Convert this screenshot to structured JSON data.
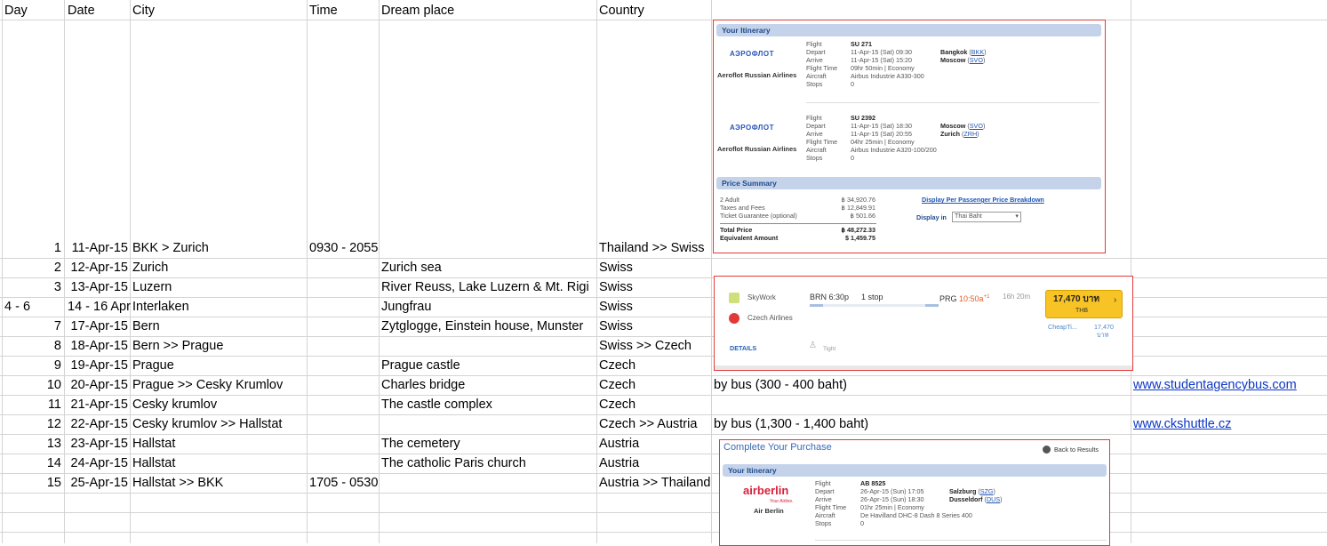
{
  "sheet": {
    "headers": [
      "Day",
      "Date",
      "City",
      "Time",
      "Dream place",
      "Country"
    ],
    "rows": [
      {
        "day": "1",
        "date": "11-Apr-15",
        "city": "BKK > Zurich",
        "time": "0930 - 2055",
        "place": "",
        "country": "Thailand >> Swiss",
        "note": "",
        "link": ""
      },
      {
        "day": "2",
        "date": "12-Apr-15",
        "city": "Zurich",
        "time": "",
        "place": "Zurich sea",
        "country": "Swiss",
        "note": "",
        "link": ""
      },
      {
        "day": "3",
        "date": "13-Apr-15",
        "city": "Luzern",
        "time": "",
        "place": "River Reuss, Lake Luzern & Mt. Rigi",
        "country": "Swiss",
        "note": "",
        "link": ""
      },
      {
        "day": "4 - 6",
        "date": "14 - 16 Apr",
        "city": "Interlaken",
        "time": "",
        "place": "Jungfrau",
        "country": "Swiss",
        "note": "",
        "link": ""
      },
      {
        "day": "7",
        "date": "17-Apr-15",
        "city": "Bern",
        "time": "",
        "place": "Zytglogge, Einstein house, Munster",
        "country": "Swiss",
        "note": "",
        "link": ""
      },
      {
        "day": "8",
        "date": "18-Apr-15",
        "city": "Bern >> Prague",
        "time": "",
        "place": "",
        "country": "Swiss >> Czech",
        "note": "",
        "link": ""
      },
      {
        "day": "9",
        "date": "19-Apr-15",
        "city": "Prague",
        "time": "",
        "place": "Prague castle",
        "country": "Czech",
        "note": "",
        "link": ""
      },
      {
        "day": "10",
        "date": "20-Apr-15",
        "city": "Prague >> Cesky Krumlov",
        "time": "",
        "place": "Charles bridge",
        "country": "Czech",
        "note": "by bus (300 - 400 baht)",
        "link": "www.studentagencybus.com"
      },
      {
        "day": "11",
        "date": "21-Apr-15",
        "city": "Cesky krumlov",
        "time": "",
        "place": "The castle complex",
        "country": "Czech",
        "note": "",
        "link": ""
      },
      {
        "day": "12",
        "date": "22-Apr-15",
        "city": "Cesky krumlov >> Hallstat",
        "time": "",
        "place": "",
        "country": "Czech >> Austria",
        "note": "by bus (1,300 - 1,400 baht)",
        "link": "www.ckshuttle.cz"
      },
      {
        "day": "13",
        "date": "23-Apr-15",
        "city": "Hallstat",
        "time": "",
        "place": "The cemetery",
        "country": "Austria",
        "note": "",
        "link": ""
      },
      {
        "day": "14",
        "date": "24-Apr-15",
        "city": "Hallstat",
        "time": "",
        "place": "The catholic Paris church",
        "country": "Austria",
        "note": "",
        "link": ""
      },
      {
        "day": "15",
        "date": "25-Apr-15",
        "city": "Hallstat >> BKK",
        "time": "1705 - 0530",
        "place": "",
        "country": "Austria >> Thailand",
        "note": "",
        "link": ""
      }
    ]
  },
  "shot1": {
    "itinerary_title": "Your Itinerary",
    "logo_text": "АЭРОФЛОТ",
    "airline": "Aeroflot Russian Airlines",
    "labels": [
      "Flight",
      "Depart",
      "Arrive",
      "Flight Time",
      "Aircraft",
      "Stops"
    ],
    "leg1": {
      "flight": "SU 271",
      "depart": "11-Apr-15 (Sat) 09:30",
      "arrive": "11-Apr-15 (Sat) 15:20",
      "time": "09hr 50min | Economy",
      "aircraft": "Airbus Industrie A330-300",
      "stops": "0",
      "from_city": "Bangkok",
      "from_code": "BKK",
      "to_city": "Moscow",
      "to_code": "SVO"
    },
    "leg2": {
      "flight": "SU 2392",
      "depart": "11-Apr-15 (Sat) 18:30",
      "arrive": "11-Apr-15 (Sat) 20:55",
      "time": "04hr 25min | Economy",
      "aircraft": "Airbus Industrie A320-100/200",
      "stops": "0",
      "from_city": "Moscow",
      "from_code": "SVO",
      "to_city": "Zurich",
      "to_code": "ZRH"
    },
    "price_title": "Price Summary",
    "price_labels": [
      "2 Adult",
      "Taxes and Fees",
      "Ticket Guarantee (optional)"
    ],
    "price_values": [
      "฿ 34,920.76",
      "฿ 12,849.91",
      "฿ 501.66"
    ],
    "total_label": "Total Price",
    "total_value": "฿ 48,272.33",
    "equiv_label": "Equivalent Amount",
    "equiv_value": "$ 1,459.75",
    "breakdown_link": "Display Per Passenger Price Breakdown",
    "display_in_label": "Display in",
    "currency_select": "Thai Baht"
  },
  "shot2": {
    "airline1": "SkyWork",
    "airline2": "Czech Airlines",
    "dep": "BRN 6:30p",
    "stops": "1 stop",
    "arr_code": "PRG",
    "arr_time": "10:50a",
    "plus": "+1",
    "duration": "16h 20m",
    "price": "17,470 บาท",
    "currency": "THB",
    "details": "DETAILS",
    "seat": "Tight",
    "provider": "CheapTi...",
    "provider_price": "17,470",
    "provider_unit": "บาท"
  },
  "shot3": {
    "title": "Complete Your Purchase",
    "back": "Back to Results",
    "itinerary_title": "Your Itinerary",
    "logo_text": "airberlin",
    "logo_tag": "Your Airline.",
    "airline": "Air Berlin",
    "labels": [
      "Flight",
      "Depart",
      "Arrive",
      "Flight Time",
      "Aircraft",
      "Stops"
    ],
    "leg": {
      "flight": "AB 8525",
      "depart": "26-Apr-15 (Sun) 17:05",
      "arrive": "26-Apr-15 (Sun) 18:30",
      "time": "01hr 25min | Economy",
      "aircraft": "De Havilland DHC-8 Dash 8 Series 400",
      "stops": "0",
      "from_city": "Salzburg",
      "from_code": "SZG",
      "to_city": "Dusseldorf",
      "to_code": "DUS"
    }
  },
  "colors": {
    "accent_bar": "#c5d3ea",
    "border_red": "#e23a3a",
    "price_btn": "#f7c325",
    "link": "#0b36c7"
  }
}
